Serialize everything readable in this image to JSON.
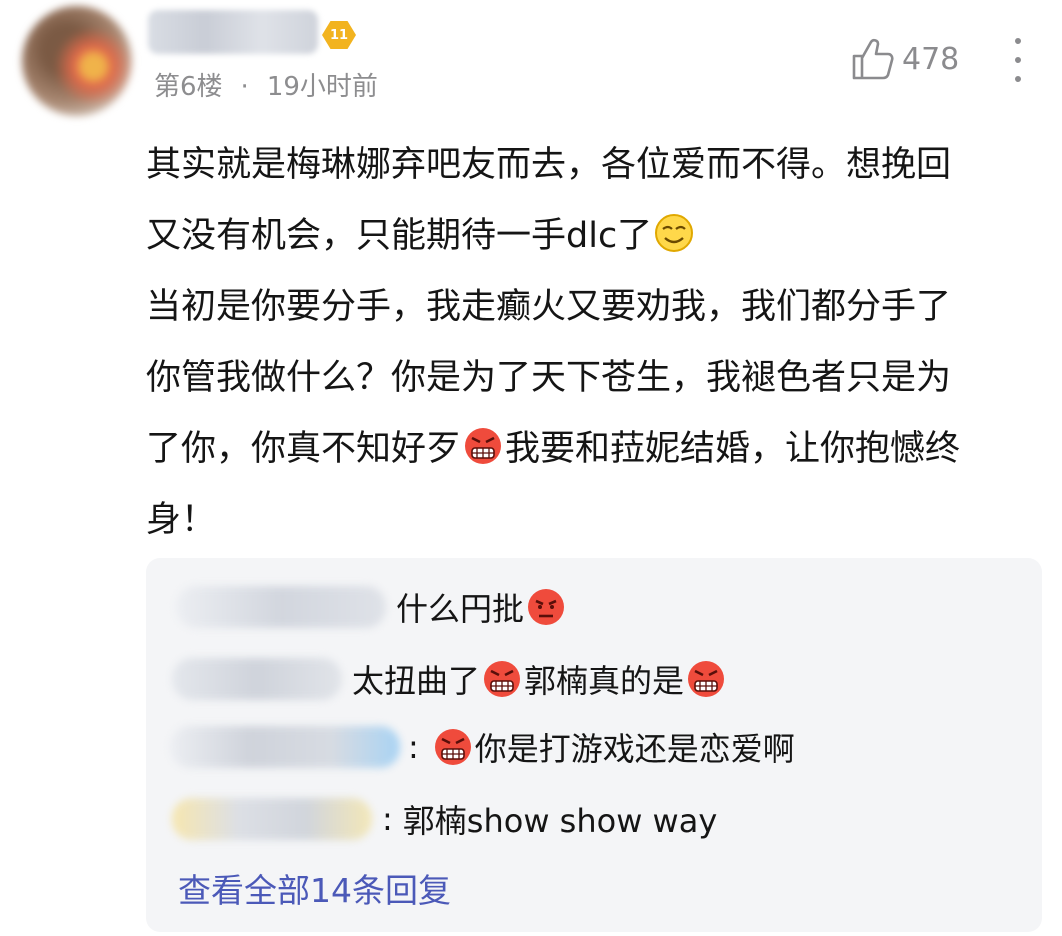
{
  "comment": {
    "level_badge": "11",
    "floor": "第6楼",
    "separator": "·",
    "time": "19小时前",
    "like_count": "478",
    "lines": [
      "其实就是梅琳娜弃吧友而去，各位爱而不得。想挽回",
      "又没有机会，只能期待一手dlc了",
      "当初是你要分手，我走癫火又要劝我，我们都分手了",
      "你管我做什么？你是为了天下苍生，我褪色者只是为",
      "了你，你真不知好歹",
      "我要和菈妮结婚，让你抱憾终",
      "身！"
    ],
    "emoji_icons": [
      "smirk-face-icon",
      "angry-grimace-icon"
    ]
  },
  "replies": {
    "items": [
      {
        "text": "什么円批",
        "icon": "angry-face-icon"
      },
      {
        "text_a": "太扭曲了",
        "text_b": "郭楠真的是",
        "icon": "angry-grimace-icon"
      },
      {
        "prefix": ":",
        "text": "你是打游戏还是恋爱啊",
        "icon": "angry-grimace-icon"
      },
      {
        "prefix": ":",
        "text": "郭楠show show way"
      }
    ],
    "view_all": "查看全部14条回复"
  },
  "colors": {
    "link": "#4b59b8",
    "meta": "#8d8d8f",
    "badge": "#f2b31f",
    "panel": "#f4f5f7"
  }
}
